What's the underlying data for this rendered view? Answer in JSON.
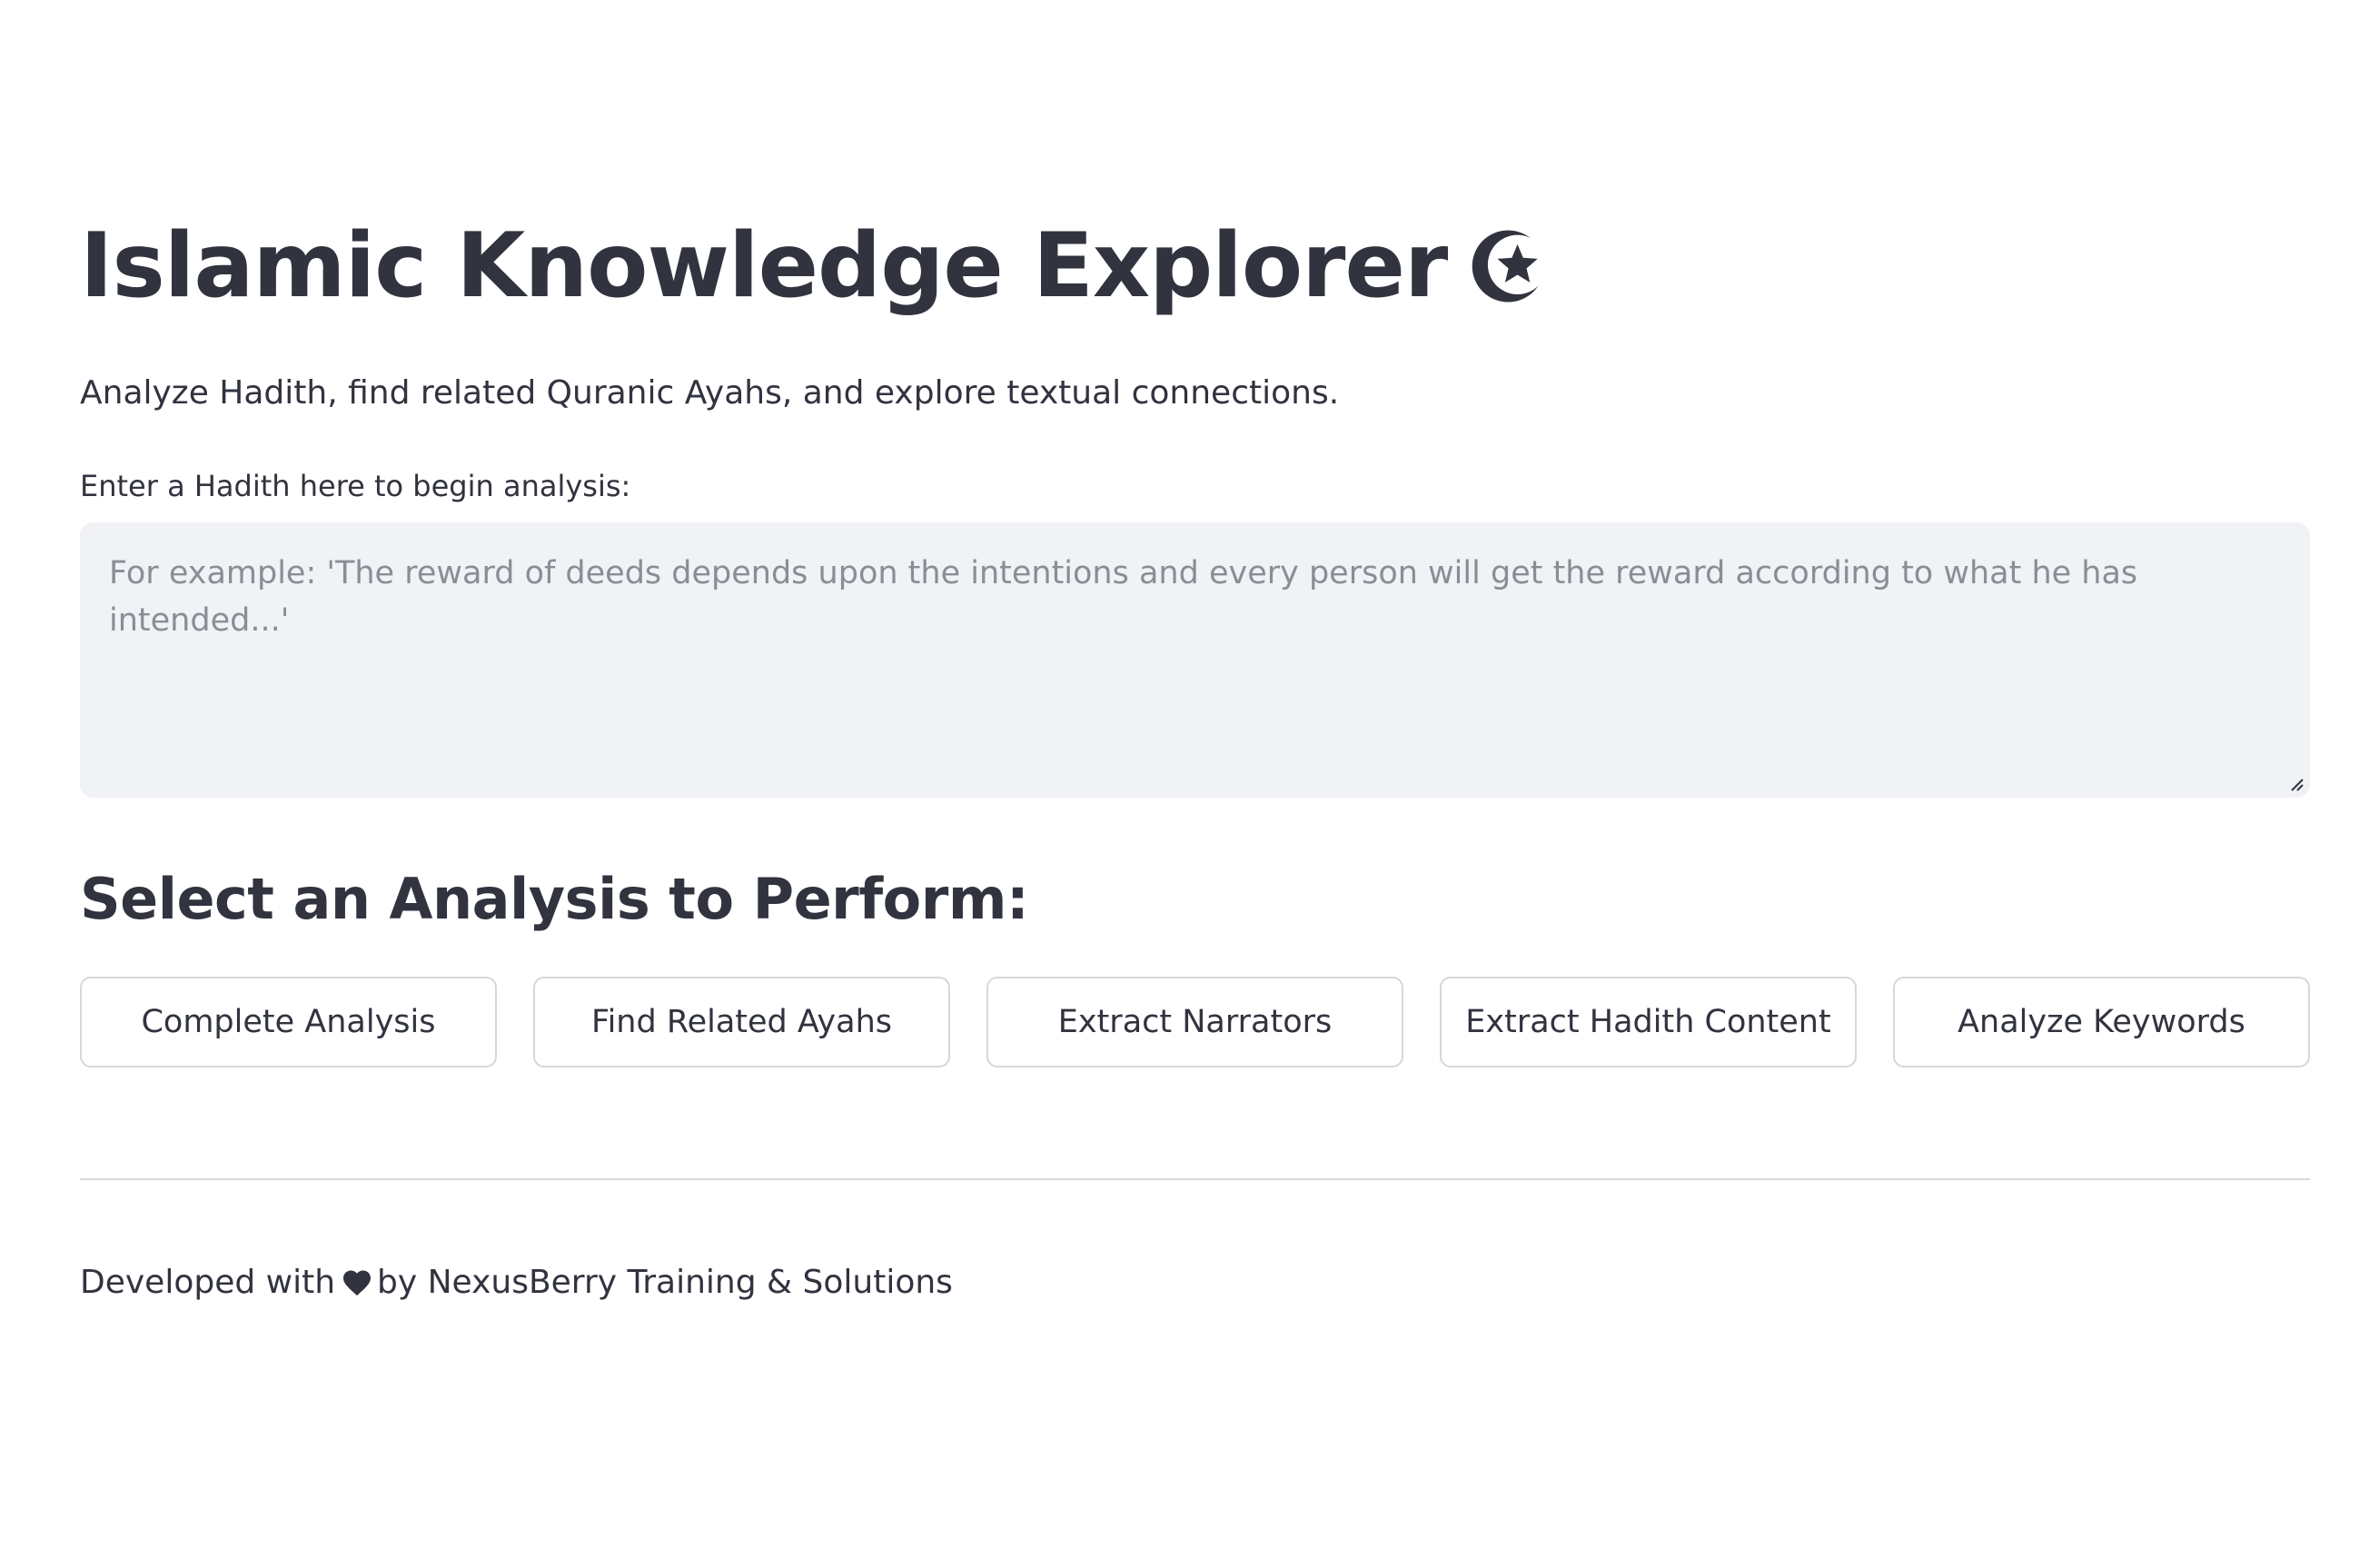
{
  "header": {
    "title": "Islamic Knowledge Explorer",
    "title_icon": "star-and-crescent-icon",
    "subtitle": "Analyze Hadith, find related Quranic Ayahs, and explore textual connections."
  },
  "hadith_input": {
    "label": "Enter a Hadith here to begin analysis:",
    "value": "",
    "placeholder": "For example: 'The reward of deeds depends upon the intentions and every person will get the reward according to what he has intended...'"
  },
  "analysis": {
    "heading": "Select an Analysis to Perform:",
    "buttons": [
      {
        "label": "Complete Analysis"
      },
      {
        "label": "Find Related Ayahs"
      },
      {
        "label": "Extract Narrators"
      },
      {
        "label": "Extract Hadith Content"
      },
      {
        "label": "Analyze Keywords"
      }
    ]
  },
  "footer": {
    "prefix": "Developed with",
    "icon": "heart-icon",
    "suffix": "by NexusBerry Training & Solutions"
  },
  "colors": {
    "text": "#31333f",
    "placeholder": "#8b8d96",
    "input_background": "#f0f2f6",
    "button_border": "#d6d7db",
    "divider": "#d9dadd"
  }
}
